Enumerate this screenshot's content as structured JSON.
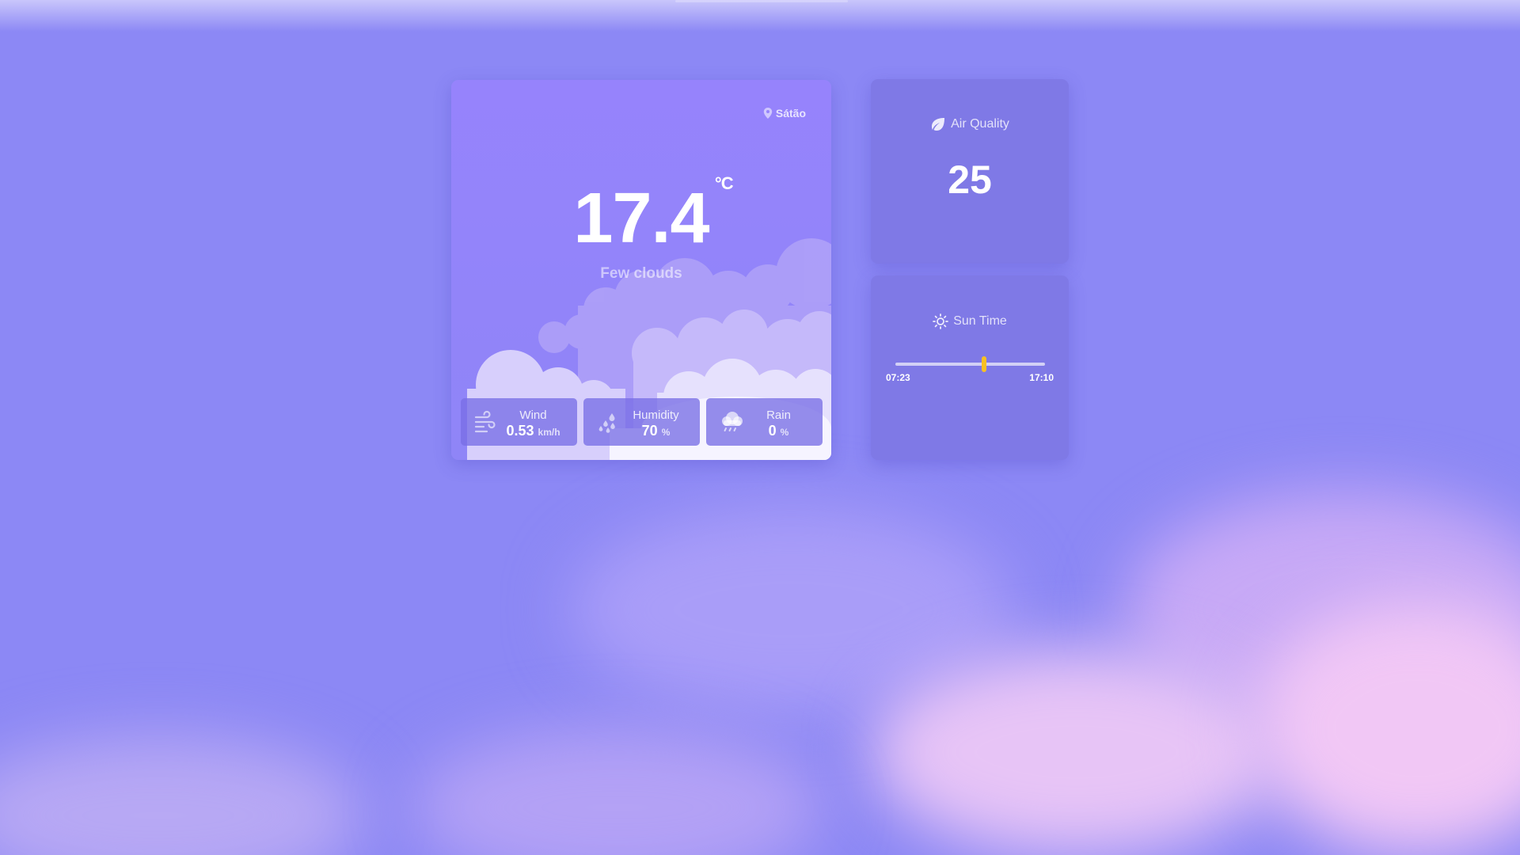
{
  "location": {
    "name": "Sátão",
    "icon": "map-pin-icon"
  },
  "weather": {
    "temperature": "17.4",
    "unit": "°C",
    "description": "Few clouds",
    "stats": [
      {
        "label": "Wind",
        "value": "0.53",
        "unit": "km/h",
        "icon": "wind-icon"
      },
      {
        "label": "Humidity",
        "value": "70",
        "unit": "%",
        "icon": "humidity-drops-icon"
      },
      {
        "label": "Rain",
        "value": "0",
        "unit": "%",
        "icon": "rain-cloud-icon"
      }
    ]
  },
  "air_quality": {
    "title": "Air Quality",
    "value": "25",
    "icon": "leaf-icon"
  },
  "sun_time": {
    "title": "Sun Time",
    "icon": "sun-icon",
    "sunrise": "07:23",
    "sunset": "17:10",
    "progress": 0.59
  },
  "colors": {
    "background": "#8c88f5",
    "card": "#9683fc",
    "side_card": "#7f79e6",
    "sun_marker": "#f8c023"
  }
}
